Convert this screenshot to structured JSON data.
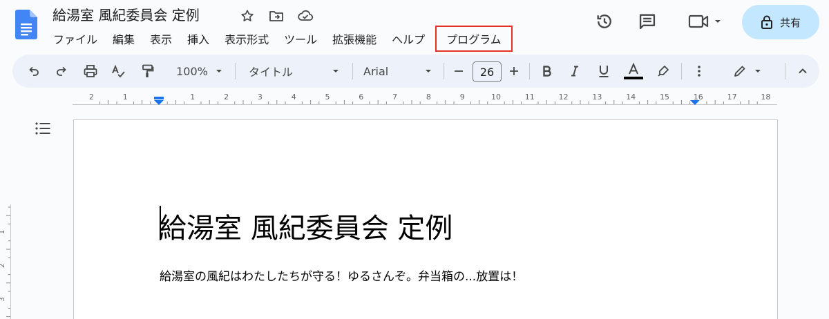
{
  "document": {
    "title": "給湯室 風紀委員会 定例",
    "heading": "給湯室 風紀委員会 定例",
    "paragraph": "給湯室の風紀はわたしたちが守る！ゆるさんぞ。弁当箱の...放置は！"
  },
  "menu": {
    "items": [
      {
        "label": "ファイル"
      },
      {
        "label": "編集"
      },
      {
        "label": "表示"
      },
      {
        "label": "挿入"
      },
      {
        "label": "表示形式"
      },
      {
        "label": "ツール"
      },
      {
        "label": "拡張機能"
      },
      {
        "label": "ヘルプ"
      },
      {
        "label": "プログラム"
      }
    ]
  },
  "share": {
    "label": "共有"
  },
  "toolbar": {
    "zoom": "100%",
    "style": "タイトル",
    "font": "Arial",
    "font_size": "26"
  },
  "ruler": {
    "labels": [
      "2",
      "1",
      "1",
      "2",
      "3",
      "4",
      "5",
      "6",
      "7",
      "8",
      "9",
      "10",
      "11",
      "12",
      "13",
      "14",
      "15",
      "16",
      "17",
      "18"
    ]
  },
  "vertical_ruler": {
    "labels": [
      "1",
      "2",
      "3"
    ]
  },
  "colors": {
    "accent": "#1a73e8",
    "share_bg": "#c2e7ff",
    "toolbar_bg": "#edf2fa",
    "highlight_border": "#e53323"
  }
}
